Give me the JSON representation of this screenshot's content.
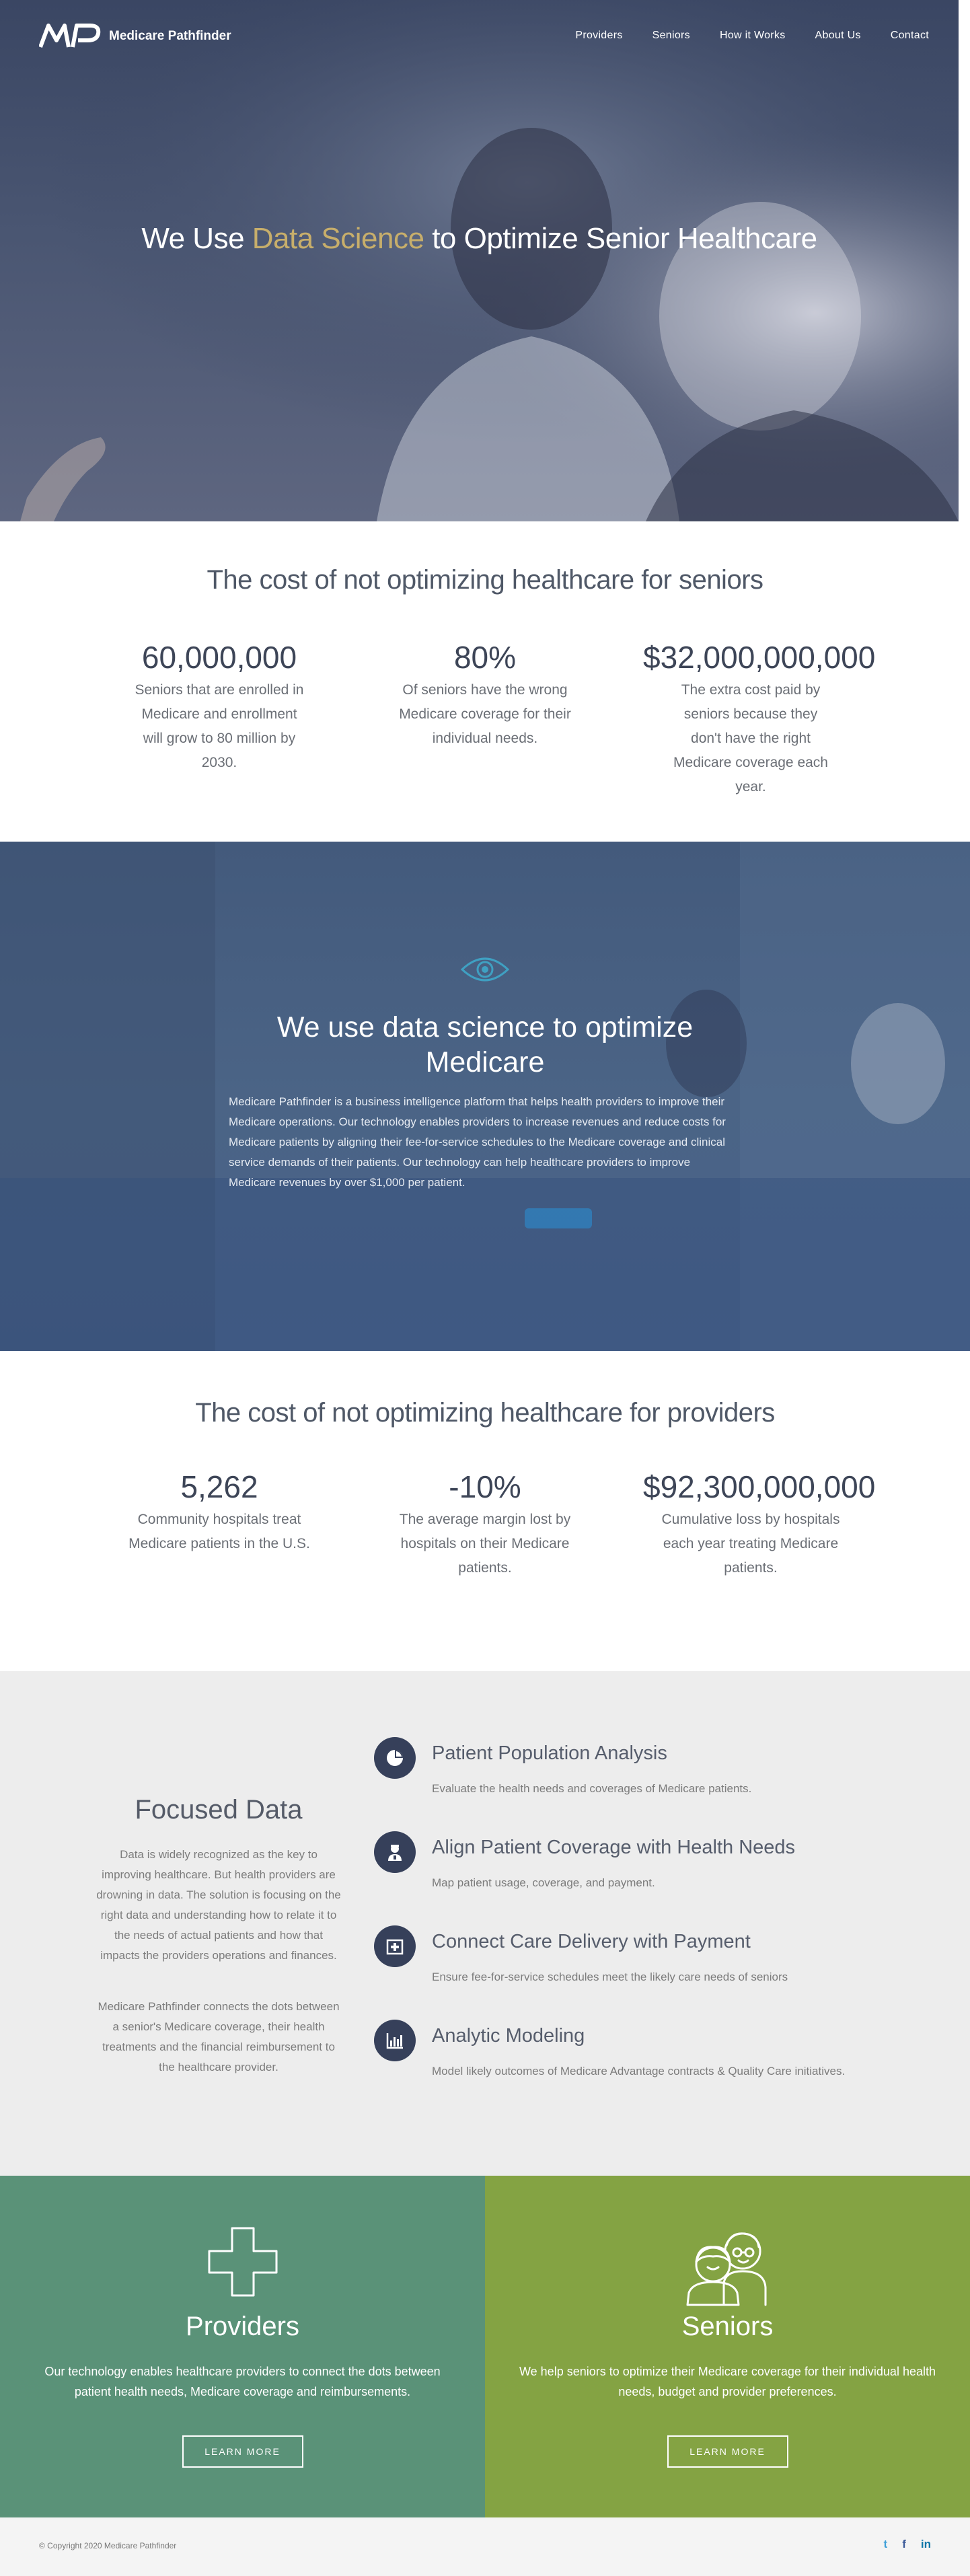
{
  "nav": {
    "brand": "Medicare Pathfinder",
    "items": [
      "Providers",
      "Seniors",
      "How it Works",
      "About Us",
      "Contact"
    ]
  },
  "hero": {
    "title_before": "We Use ",
    "title_accent": "Data Science",
    "title_after": " to Optimize Senior Healthcare"
  },
  "seniors_stats": {
    "title": "The cost of not optimizing healthcare for seniors",
    "items": [
      {
        "value": "60,000,000",
        "desc": "Seniors that are enrolled in Medicare and enrollment will grow to 80 million by 2030."
      },
      {
        "value": "80%",
        "desc": "Of seniors have the wrong Medicare coverage for their individual needs."
      },
      {
        "value": "$32,000,000,000",
        "desc": "The extra cost paid by seniors because they don't have the right Medicare coverage each year."
      }
    ]
  },
  "data_science": {
    "icon": "eye-icon",
    "title": "We use data science to optimize Medicare",
    "body": "Medicare Pathfinder is a business intelligence platform that helps health providers to improve their Medicare operations. Our technology enables providers to increase revenues and reduce costs for Medicare patients by aligning their fee-for-service schedules to the Medicare coverage and clinical service demands of their patients. Our technology can help healthcare providers to improve Medicare revenues by over $1,000 per patient."
  },
  "provider_stats": {
    "title": "The cost of not optimizing healthcare for providers",
    "items": [
      {
        "value": "5,262",
        "desc": "Community hospitals treat Medicare patients in the U.S."
      },
      {
        "value": "-10%",
        "desc": "The average margin lost by hospitals on their Medicare patients."
      },
      {
        "value": "$92,300,000,000",
        "desc": "Cumulative loss by hospitals each year treating Medicare patients."
      }
    ]
  },
  "focused_data": {
    "title": "Focused Data",
    "para1": "Data is widely recognized as the key to improving healthcare. But health providers are drowning in data. The solution is focusing on the right data and understanding how to relate it to the needs of actual patients and how that impacts the providers operations and finances.",
    "para2": "Medicare Pathfinder connects the dots between a senior's Medicare coverage, their health treatments and the financial reimbursement to the healthcare provider.",
    "features": [
      {
        "icon": "pie-chart-icon",
        "title": "Patient Population Analysis",
        "desc": "Evaluate the health needs and coverages of Medicare patients."
      },
      {
        "icon": "doctor-icon",
        "title": "Align Patient Coverage with Health Needs",
        "desc": "Map patient usage, coverage, and payment."
      },
      {
        "icon": "medical-kit-icon",
        "title": "Connect Care Delivery with Payment",
        "desc": "Ensure fee-for-service schedules meet the likely care needs of seniors"
      },
      {
        "icon": "bar-chart-icon",
        "title": "Analytic Modeling",
        "desc": "Model likely outcomes of Medicare Advantage contracts & Quality Care initiatives."
      }
    ]
  },
  "providers": {
    "icon": "cross-icon",
    "title": "Providers",
    "body": "Our technology enables healthcare providers to connect the dots between patient health needs, Medicare coverage and reimbursements.",
    "button": "LEARN MORE",
    "color": "#5a9278"
  },
  "seniors": {
    "icon": "seniors-couple-icon",
    "title": "Seniors",
    "body": "We help seniors to optimize their Medicare coverage for their individual health needs, budget and provider preferences.",
    "button": "LEARN MORE",
    "color": "#84a343"
  },
  "footer": {
    "copyright": "© Copyright 2020 Medicare Pathfinder",
    "social": [
      "twitter-icon",
      "facebook-icon",
      "linkedin-icon"
    ],
    "social_glyphs": [
      "t",
      "f",
      "in"
    ]
  },
  "colors": {
    "accent_gold": "#c7ae6b",
    "navy": "#36405a",
    "icon_teal": "#3fa0c2"
  }
}
